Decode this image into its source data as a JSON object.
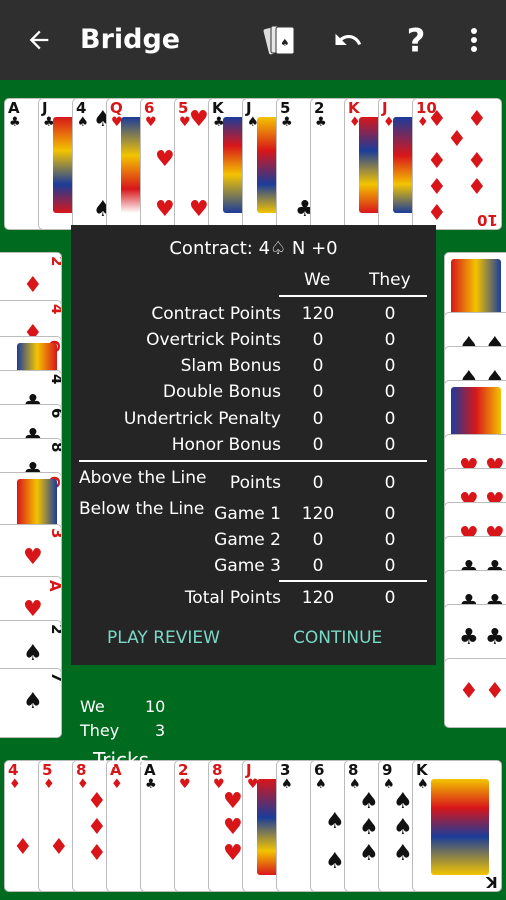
{
  "app": {
    "title": "Bridge"
  },
  "icons": [
    "back-arrow-icon",
    "cards-icon",
    "undo-icon",
    "help-icon",
    "overflow-menu-icon"
  ],
  "contract": {
    "prefix": "Contract: 4",
    "suit_symbol": "♤",
    "suffix": "N +0"
  },
  "score": {
    "col_we": "We",
    "col_they": "They",
    "rows": [
      {
        "label": "Contract Points",
        "we": "120",
        "they": "0"
      },
      {
        "label": "Overtrick Points",
        "we": "0",
        "they": "0"
      },
      {
        "label": "Slam Bonus",
        "we": "0",
        "they": "0"
      },
      {
        "label": "Double Bonus",
        "we": "0",
        "they": "0"
      },
      {
        "label": "Undertrick Penalty",
        "we": "0",
        "they": "0"
      },
      {
        "label": "Honor Bonus",
        "we": "0",
        "they": "0"
      }
    ],
    "above_line": {
      "label": "Above the Line",
      "sub": "Points",
      "we": "0",
      "they": "0"
    },
    "below_line": {
      "label": "Below the Line",
      "games": [
        {
          "label": "Game 1",
          "we": "120",
          "they": "0"
        },
        {
          "label": "Game 2",
          "we": "0",
          "they": "0"
        },
        {
          "label": "Game 3",
          "we": "0",
          "they": "0"
        }
      ]
    },
    "total": {
      "label": "Total Points",
      "we": "120",
      "they": "0"
    }
  },
  "buttons": {
    "play_review": "PLAY REVIEW",
    "continue": "CONTINUE"
  },
  "tricks": {
    "title": "Tricks",
    "we_label": "We",
    "we_value": "10",
    "they_label": "They",
    "they_value": "3"
  },
  "colors": {
    "felt": "#006a1f",
    "appbar": "#2f2f2f",
    "dialog": "#252525",
    "accent": "#7ad9c6",
    "red_suit": "#d8161a"
  }
}
